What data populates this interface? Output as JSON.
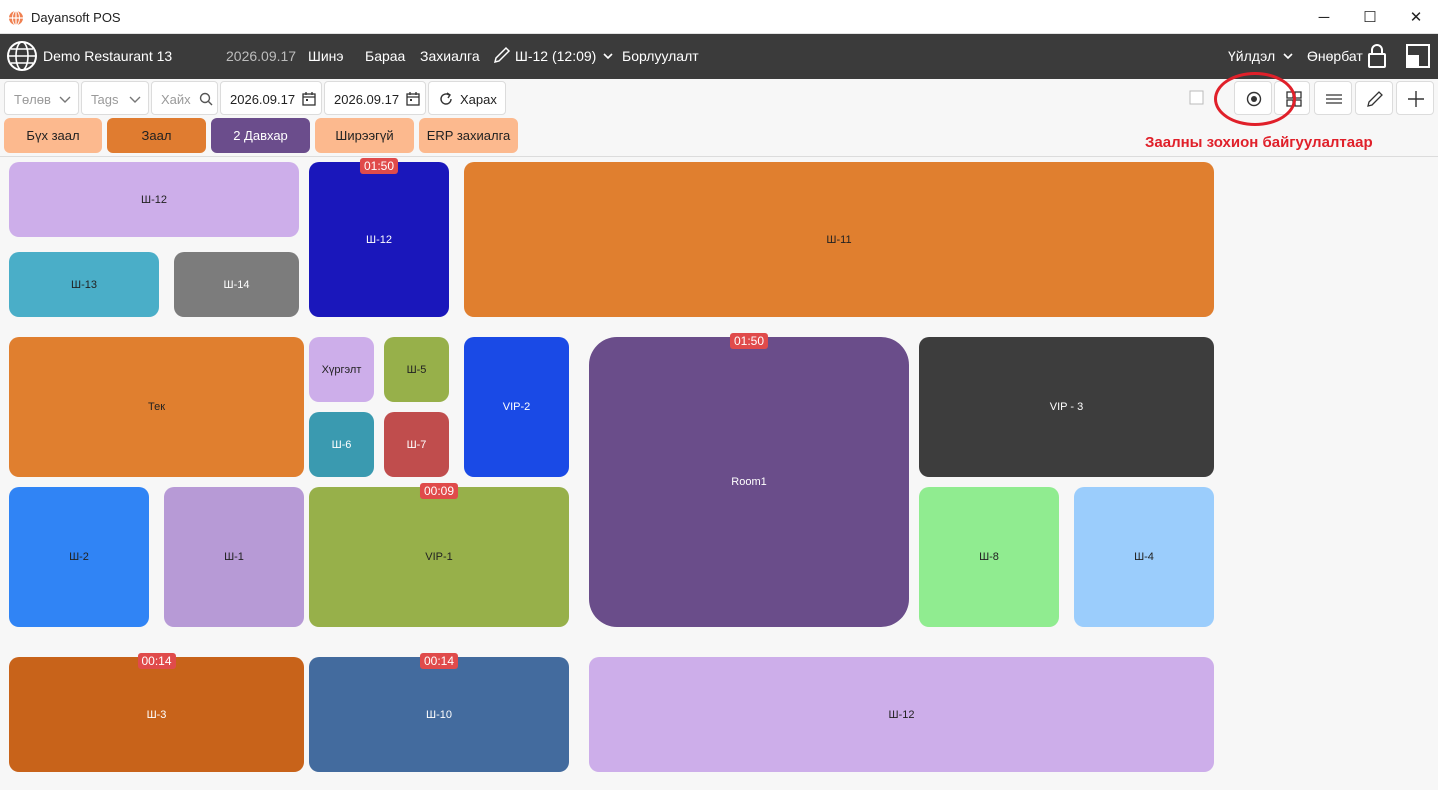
{
  "window": {
    "title": "Dayansoft POS",
    "minimize": "─",
    "maximize": "☐",
    "close": "✕"
  },
  "menu": {
    "restaurant": "Demo Restaurant 13",
    "date": "2026.09.17",
    "new": "Шинэ",
    "goods": "Бараа",
    "order": "Захиалга",
    "current_table": "Ш-12 (12:09)",
    "sales": "Борлуулалт",
    "actions": "Үйлдэл",
    "user": "Өнөрбат"
  },
  "filters": {
    "payment_placeholder": "Төлөв",
    "tags_placeholder": "Tags",
    "search_placeholder": "Хайх",
    "date_from": "2026.09.17",
    "date_to": "2026.09.17",
    "refresh_label": "Харах"
  },
  "halls": [
    {
      "label": "Бүх заал",
      "color": "#fcb98e"
    },
    {
      "label": "Заал",
      "color": "#e07c30"
    },
    {
      "label": "2 Давхар",
      "color": "#6b4d8c"
    },
    {
      "label": "Ширээгүй",
      "color": "#fcb98e"
    },
    {
      "label": "ERP захиалга",
      "color": "#fcb98e"
    }
  ],
  "annotation": "Заалны зохион байгуулалтаар",
  "tables": [
    {
      "label": "Ш-12",
      "color": "#cdaeea",
      "text": "#222"
    },
    {
      "label": "Ш-12",
      "color": "#1a17bb",
      "text": "#fff",
      "timer": "01:50"
    },
    {
      "label": "Ш-11",
      "color": "#e07f2f",
      "text": "#222"
    },
    {
      "label": "Ш-13",
      "color": "#4aaec8",
      "text": "#222"
    },
    {
      "label": "Ш-14",
      "color": "#7c7c7c",
      "text": "#fff"
    },
    {
      "label": "Тек",
      "color": "#e07f2f",
      "text": "#222"
    },
    {
      "label": "Хүргэлт",
      "color": "#cdaeea",
      "text": "#222"
    },
    {
      "label": "Ш-5",
      "color": "#97b04a",
      "text": "#222"
    },
    {
      "label": "Ш-6",
      "color": "#3a9ab0",
      "text": "#fff"
    },
    {
      "label": "Ш-7",
      "color": "#c04d4d",
      "text": "#fff"
    },
    {
      "label": "VIP-2",
      "color": "#1a4ae6",
      "text": "#fff"
    },
    {
      "label": "Room1",
      "color": "#6a4d8a",
      "text": "#fff",
      "timer": "01:50"
    },
    {
      "label": "VIP - 3",
      "color": "#3d3d3d",
      "text": "#fff"
    },
    {
      "label": "Ш-2",
      "color": "#3084f5",
      "text": "#222"
    },
    {
      "label": "Ш-1",
      "color": "#b79ad6",
      "text": "#222"
    },
    {
      "label": "VIP-1",
      "color": "#97b04a",
      "text": "#222",
      "timer": "00:09"
    },
    {
      "label": "Ш-8",
      "color": "#90ec90",
      "text": "#222"
    },
    {
      "label": "Ш-4",
      "color": "#9bcdfc",
      "text": "#222"
    },
    {
      "label": "Ш-3",
      "color": "#c8631a",
      "text": "#fff",
      "timer": "00:14"
    },
    {
      "label": "Ш-10",
      "color": "#436b9e",
      "text": "#fff",
      "timer": "00:14"
    },
    {
      "label": "Ш-12",
      "color": "#cdaeea",
      "text": "#222"
    }
  ]
}
